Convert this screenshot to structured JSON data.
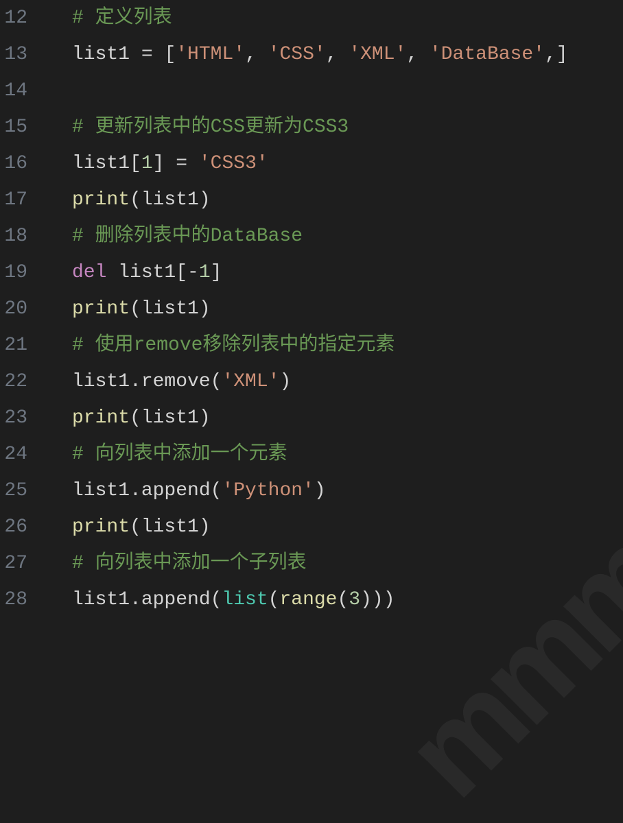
{
  "editor": {
    "startLine": 12,
    "lines": [
      {
        "num": "12",
        "tokens": [
          {
            "t": "# 定义列表",
            "c": "comment"
          }
        ]
      },
      {
        "num": "13",
        "tokens": [
          {
            "t": "list1 ",
            "c": "variable"
          },
          {
            "t": "=",
            "c": "operator"
          },
          {
            "t": " [",
            "c": "punct"
          },
          {
            "t": "'HTML'",
            "c": "string"
          },
          {
            "t": ", ",
            "c": "punct"
          },
          {
            "t": "'CSS'",
            "c": "string"
          },
          {
            "t": ", ",
            "c": "punct"
          },
          {
            "t": "'XML'",
            "c": "string"
          },
          {
            "t": ", ",
            "c": "punct"
          },
          {
            "t": "'DataBase'",
            "c": "string"
          },
          {
            "t": ",]",
            "c": "punct"
          }
        ]
      },
      {
        "num": "14",
        "tokens": []
      },
      {
        "num": "15",
        "tokens": [
          {
            "t": "# 更新列表中的CSS更新为CSS3",
            "c": "comment"
          }
        ]
      },
      {
        "num": "16",
        "tokens": [
          {
            "t": "list1[",
            "c": "variable"
          },
          {
            "t": "1",
            "c": "number"
          },
          {
            "t": "] ",
            "c": "variable"
          },
          {
            "t": "=",
            "c": "operator"
          },
          {
            "t": " ",
            "c": "punct"
          },
          {
            "t": "'CSS3'",
            "c": "string"
          }
        ]
      },
      {
        "num": "17",
        "tokens": [
          {
            "t": "print",
            "c": "builtin"
          },
          {
            "t": "(list1)",
            "c": "variable"
          }
        ]
      },
      {
        "num": "18",
        "tokens": [
          {
            "t": "# 删除列表中的DataBase",
            "c": "comment"
          }
        ]
      },
      {
        "num": "19",
        "tokens": [
          {
            "t": "del",
            "c": "keyword"
          },
          {
            "t": " list1[",
            "c": "variable"
          },
          {
            "t": "-",
            "c": "operator"
          },
          {
            "t": "1",
            "c": "number"
          },
          {
            "t": "]",
            "c": "variable"
          }
        ]
      },
      {
        "num": "20",
        "tokens": [
          {
            "t": "print",
            "c": "builtin"
          },
          {
            "t": "(list1)",
            "c": "variable"
          }
        ]
      },
      {
        "num": "21",
        "tokens": [
          {
            "t": "# 使用remove移除列表中的指定元素",
            "c": "comment"
          }
        ]
      },
      {
        "num": "22",
        "tokens": [
          {
            "t": "list1.remove(",
            "c": "variable"
          },
          {
            "t": "'XML'",
            "c": "string"
          },
          {
            "t": ")",
            "c": "variable"
          }
        ]
      },
      {
        "num": "23",
        "tokens": [
          {
            "t": "print",
            "c": "builtin"
          },
          {
            "t": "(list1)",
            "c": "variable"
          }
        ]
      },
      {
        "num": "24",
        "tokens": [
          {
            "t": "# 向列表中添加一个元素",
            "c": "comment"
          }
        ]
      },
      {
        "num": "25",
        "tokens": [
          {
            "t": "list1.append(",
            "c": "variable"
          },
          {
            "t": "'Python'",
            "c": "string"
          },
          {
            "t": ")",
            "c": "variable"
          }
        ]
      },
      {
        "num": "26",
        "tokens": [
          {
            "t": "print",
            "c": "builtin"
          },
          {
            "t": "(list1)",
            "c": "variable"
          }
        ]
      },
      {
        "num": "27",
        "tokens": [
          {
            "t": "# 向列表中添加一个子列表",
            "c": "comment"
          }
        ]
      },
      {
        "num": "28",
        "tokens": [
          {
            "t": "list1.append(",
            "c": "variable"
          },
          {
            "t": "list",
            "c": "func"
          },
          {
            "t": "(",
            "c": "punct"
          },
          {
            "t": "range",
            "c": "builtin"
          },
          {
            "t": "(",
            "c": "punct"
          },
          {
            "t": "3",
            "c": "number"
          },
          {
            "t": ")))",
            "c": "punct"
          }
        ]
      }
    ],
    "watermark": "mmm"
  }
}
